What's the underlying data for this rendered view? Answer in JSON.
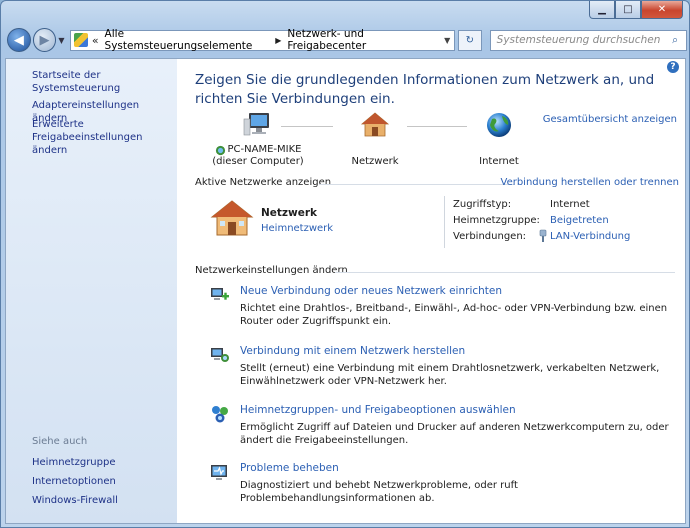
{
  "window": {
    "caption_buttons": {
      "minimize": "▁",
      "maximize": "□",
      "close": "✕"
    }
  },
  "navbar": {
    "back_glyph": "◀",
    "forward_glyph": "▶",
    "dropdown_glyph": "▼",
    "breadcrumb_prefix": "«",
    "breadcrumb": [
      "Alle Systemsteuerungselemente",
      "Netzwerk- und Freigabecenter"
    ],
    "breadcrumb_sep": "▶",
    "address_dropdown": "▼",
    "refresh_glyph": "↻",
    "search_placeholder": "Systemsteuerung durchsuchen",
    "search_icon": "⌕"
  },
  "sidebar": {
    "links": [
      "Startseite der Systemsteuerung",
      "Adaptereinstellungen ändern",
      "Erweiterte Freigabeeinstellungen ändern"
    ],
    "see_also_title": "Siehe auch",
    "see_also": [
      "Heimnetzgruppe",
      "Internetoptionen",
      "Windows-Firewall"
    ]
  },
  "main": {
    "help_glyph": "?",
    "headline": "Zeigen Sie die grundlegenden Informationen zum Netzwerk an, und richten Sie Verbindungen ein.",
    "full_map_link": "Gesamtübersicht anzeigen",
    "map": {
      "computer_name": "PC-NAME-MIKE",
      "computer_sub": "(dieser Computer)",
      "network": "Netzwerk",
      "internet": "Internet"
    },
    "active_title": "Aktive Netzwerke anzeigen",
    "connect_link": "Verbindung herstellen oder trennen",
    "active_network": {
      "name": "Netzwerk",
      "type": "Heimnetzwerk",
      "access_type_label": "Zugriffstyp:",
      "access_type_value": "Internet",
      "homegroup_label": "Heimnetzgruppe:",
      "homegroup_value": "Beigetreten",
      "connections_label": "Verbindungen:",
      "connections_value": "LAN-Verbindung"
    },
    "settings_title": "Netzwerkeinstellungen ändern",
    "tasks": [
      {
        "title": "Neue Verbindung oder neues Netzwerk einrichten",
        "desc": "Richtet eine Drahtlos-, Breitband-, Einwähl-, Ad-hoc- oder VPN-Verbindung bzw. einen Router oder Zugriffspunkt ein."
      },
      {
        "title": "Verbindung mit einem Netzwerk herstellen",
        "desc": "Stellt (erneut) eine Verbindung mit einem Drahtlosnetzwerk, verkabelten Netzwerk, Einwählnetzwerk oder VPN-Netzwerk her."
      },
      {
        "title": "Heimnetzgruppen- und Freigabeoptionen auswählen",
        "desc": "Ermöglicht Zugriff auf Dateien und Drucker auf anderen Netzwerkcomputern zu, oder ändert die Freigabeeinstellungen."
      },
      {
        "title": "Probleme beheben",
        "desc": "Diagnostiziert und behebt Netzwerkprobleme, oder ruft Problembehandlungsinformationen ab."
      }
    ]
  }
}
